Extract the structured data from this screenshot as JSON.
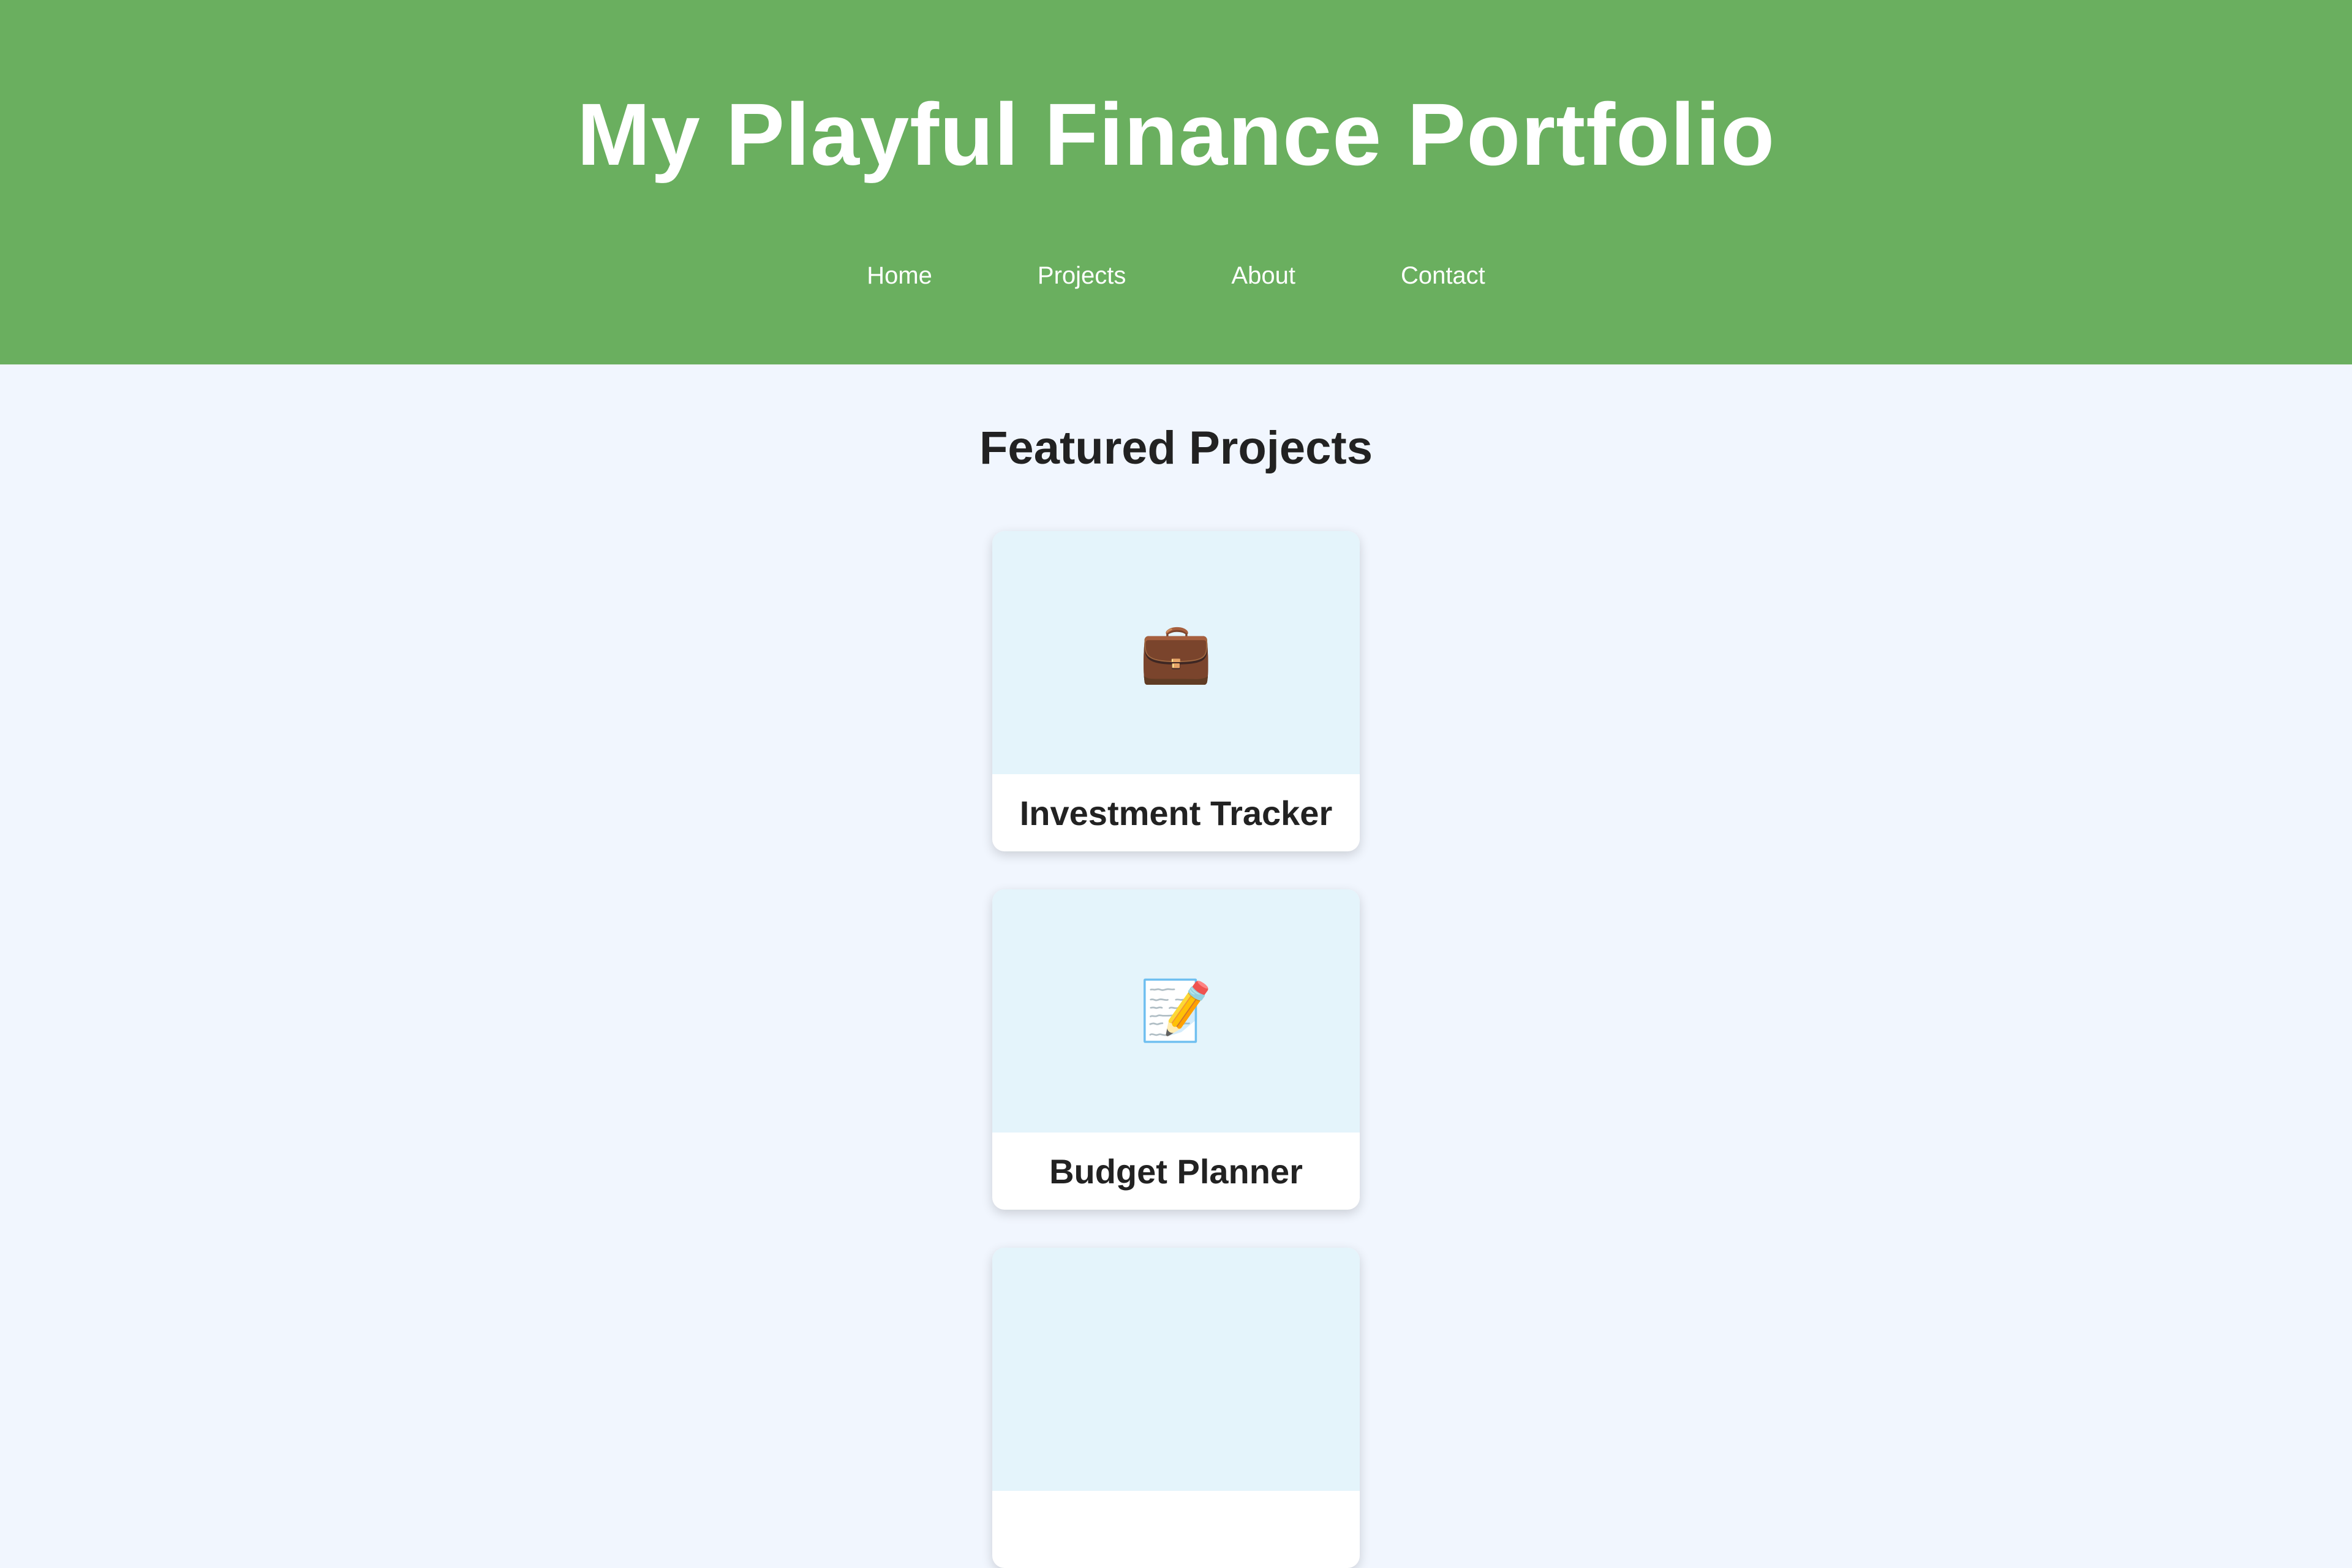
{
  "header": {
    "title": "My Playful Finance Portfolio",
    "bg_color": "#6aaf5f"
  },
  "nav": {
    "items": [
      {
        "label": "Home"
      },
      {
        "label": "Projects"
      },
      {
        "label": "About"
      },
      {
        "label": "Contact"
      }
    ]
  },
  "main": {
    "section_title": "Featured Projects",
    "projects": [
      {
        "title": "Investment Tracker",
        "icon": "💼",
        "icon_name": "briefcase-icon"
      },
      {
        "title": "Budget Planner",
        "icon": "📝",
        "icon_name": "memo-icon"
      },
      {
        "title": "",
        "icon": "",
        "icon_name": "project-thumbnail"
      }
    ]
  },
  "colors": {
    "page_bg": "#f1f6fe",
    "card_thumb_bg": "#e4f4fb"
  }
}
